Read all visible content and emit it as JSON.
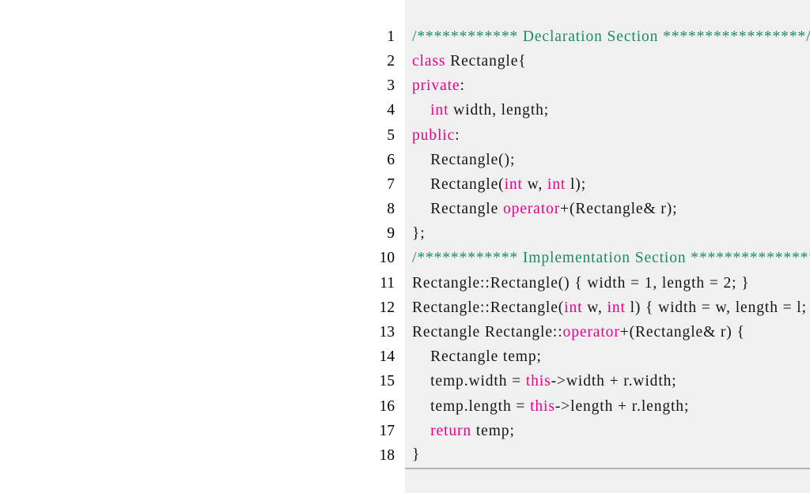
{
  "listing": {
    "language": "C++",
    "background": "#f0f0f0",
    "gutter_background": "#ffffff",
    "keyword_color": "#ec008c",
    "comment_color": "#1a8a6b",
    "text_color": "#141414",
    "rule_color": "#b4b4b4",
    "lines": [
      {
        "number": "1",
        "tokens": [
          {
            "t": "cmt",
            "s": "/************ Declaration Section *****************/"
          }
        ]
      },
      {
        "number": "2",
        "tokens": [
          {
            "t": "kw",
            "s": "class"
          },
          {
            "t": "plain",
            "s": " Rectangle{"
          }
        ]
      },
      {
        "number": "3",
        "tokens": [
          {
            "t": "kw",
            "s": "private"
          },
          {
            "t": "plain",
            "s": ":"
          }
        ]
      },
      {
        "number": "4",
        "tokens": [
          {
            "t": "plain",
            "s": "    "
          },
          {
            "t": "kw",
            "s": "int"
          },
          {
            "t": "plain",
            "s": " width, length;"
          }
        ]
      },
      {
        "number": "5",
        "tokens": [
          {
            "t": "kw",
            "s": "public"
          },
          {
            "t": "plain",
            "s": ":"
          }
        ]
      },
      {
        "number": "6",
        "tokens": [
          {
            "t": "plain",
            "s": "    Rectangle();"
          }
        ]
      },
      {
        "number": "7",
        "tokens": [
          {
            "t": "plain",
            "s": "    Rectangle("
          },
          {
            "t": "kw",
            "s": "int"
          },
          {
            "t": "plain",
            "s": " w, "
          },
          {
            "t": "kw",
            "s": "int"
          },
          {
            "t": "plain",
            "s": " l);"
          }
        ]
      },
      {
        "number": "8",
        "tokens": [
          {
            "t": "plain",
            "s": "    Rectangle "
          },
          {
            "t": "kw",
            "s": "operator"
          },
          {
            "t": "plain",
            "s": "+(Rectangle& r);"
          }
        ]
      },
      {
        "number": "9",
        "tokens": [
          {
            "t": "plain",
            "s": "};"
          }
        ]
      },
      {
        "number": "10",
        "tokens": [
          {
            "t": "cmt",
            "s": "/************ Implementation Section ****************/"
          }
        ]
      },
      {
        "number": "11",
        "tokens": [
          {
            "t": "plain",
            "s": "Rectangle::Rectangle() { width = 1, length = 2; }"
          }
        ]
      },
      {
        "number": "12",
        "tokens": [
          {
            "t": "plain",
            "s": "Rectangle::Rectangle("
          },
          {
            "t": "kw",
            "s": "int"
          },
          {
            "t": "plain",
            "s": " w, "
          },
          {
            "t": "kw",
            "s": "int"
          },
          {
            "t": "plain",
            "s": " l) { width = w, length = l; }"
          }
        ]
      },
      {
        "number": "13",
        "tokens": [
          {
            "t": "plain",
            "s": "Rectangle Rectangle::"
          },
          {
            "t": "kw",
            "s": "operator"
          },
          {
            "t": "plain",
            "s": "+(Rectangle& r) {"
          }
        ]
      },
      {
        "number": "14",
        "tokens": [
          {
            "t": "plain",
            "s": "    Rectangle temp;"
          }
        ]
      },
      {
        "number": "15",
        "tokens": [
          {
            "t": "plain",
            "s": "    temp.width = "
          },
          {
            "t": "kw",
            "s": "this"
          },
          {
            "t": "plain",
            "s": "->width + r.width;"
          }
        ]
      },
      {
        "number": "16",
        "tokens": [
          {
            "t": "plain",
            "s": "    temp.length = "
          },
          {
            "t": "kw",
            "s": "this"
          },
          {
            "t": "plain",
            "s": "->length + r.length;"
          }
        ]
      },
      {
        "number": "17",
        "tokens": [
          {
            "t": "plain",
            "s": "    "
          },
          {
            "t": "kw",
            "s": "return"
          },
          {
            "t": "plain",
            "s": " temp;"
          }
        ]
      },
      {
        "number": "18",
        "tokens": [
          {
            "t": "plain",
            "s": "}"
          }
        ]
      }
    ]
  }
}
